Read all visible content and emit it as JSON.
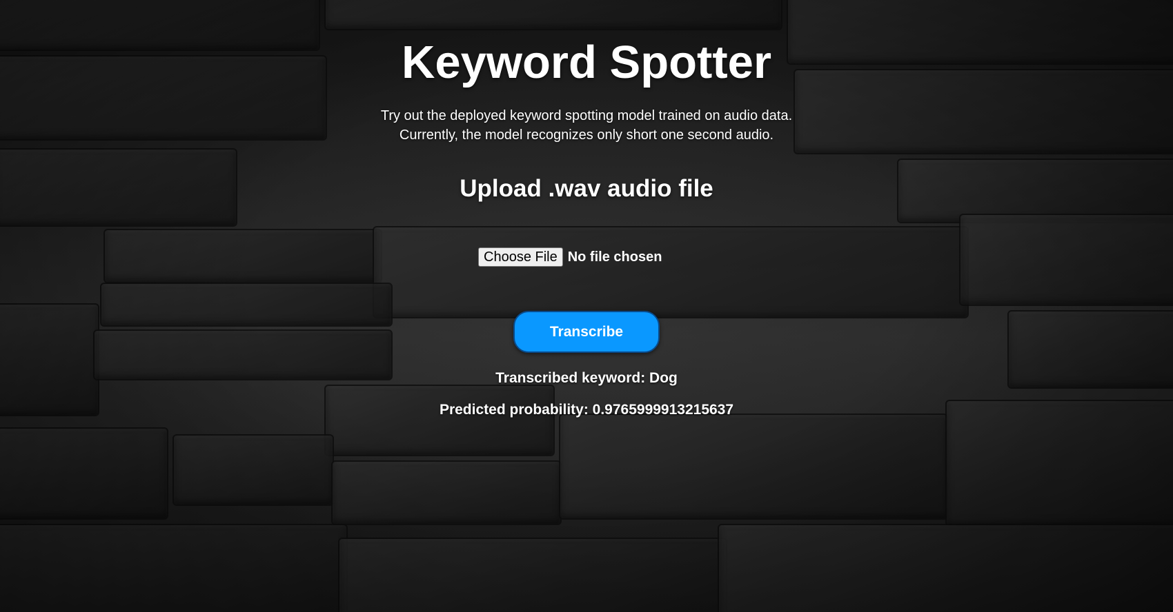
{
  "page": {
    "title": "Keyword Spotter",
    "subtitle_line1": "Try out the deployed keyword spotting model trained on audio data.",
    "subtitle_line2": "Currently, the model recognizes only short one second audio."
  },
  "upload": {
    "heading": "Upload .wav audio file",
    "choose_file_label": "Choose File",
    "file_status": "No file chosen"
  },
  "actions": {
    "transcribe_label": "Transcribe"
  },
  "results": {
    "keyword_text": "Transcribed keyword: Dog",
    "probability_text": "Predicted probability: 0.9765999913215637"
  },
  "colors": {
    "accent": "#0a98ff",
    "text": "#ffffff",
    "background": "#1a1a1a"
  }
}
